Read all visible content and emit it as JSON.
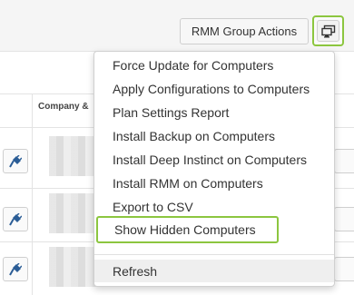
{
  "toolbar": {
    "group_actions_label": "RMM Group Actions",
    "menu_toggle_icon": "monitor-settings-icon"
  },
  "table": {
    "column_header": "Company &",
    "row_icon": "plug-icon"
  },
  "menu": {
    "items": [
      "Force Update for Computers",
      "Apply Configurations to Computers",
      "Plan Settings Report",
      "Install Backup on Computers",
      "Install Deep Instinct on Computers",
      "Install RMM on Computers",
      "Export to CSV",
      "Show Hidden Computers"
    ],
    "refresh": "Refresh"
  },
  "colors": {
    "highlight": "#8cc63f",
    "icon_blue": "#2b5d96"
  }
}
